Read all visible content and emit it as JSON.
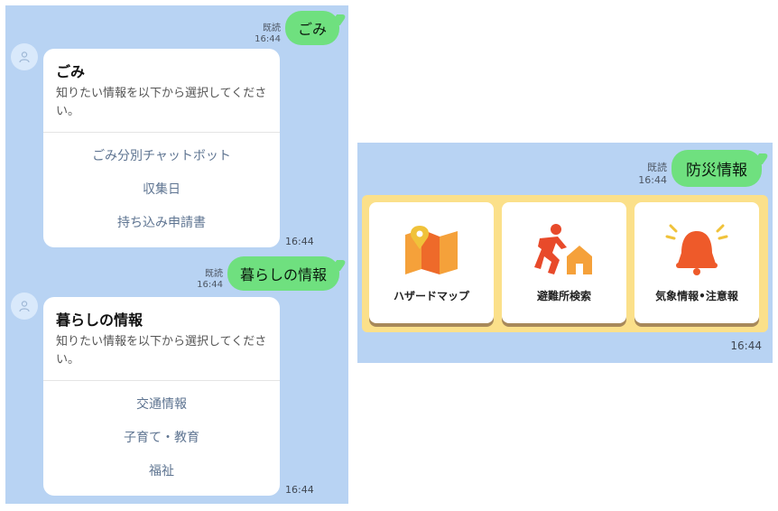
{
  "left": {
    "msg1": {
      "read": "既読",
      "time": "16:44",
      "text": "ごみ"
    },
    "card1": {
      "title": "ごみ",
      "desc": "知りたい情報を以下から選択してください。",
      "buttons": [
        "ごみ分別チャットボット",
        "収集日",
        "持ち込み申請書"
      ],
      "time": "16:44"
    },
    "msg2": {
      "read": "既読",
      "time": "16:44",
      "text": "暮らしの情報"
    },
    "card2": {
      "title": "暮らしの情報",
      "desc": "知りたい情報を以下から選択してください。",
      "buttons": [
        "交通情報",
        "子育て・教育",
        "福祉"
      ],
      "time": "16:44"
    }
  },
  "right": {
    "msg": {
      "read": "既読",
      "time": "16:44",
      "text": "防災情報"
    },
    "tiles": [
      {
        "label": "ハザードマップ",
        "icon": "map-pin-icon"
      },
      {
        "label": "避難所検索",
        "icon": "evacuation-run-icon"
      },
      {
        "label": "気象情報•注意報",
        "icon": "alarm-bell-icon"
      }
    ],
    "time": "16:44"
  },
  "colors": {
    "chat_bg": "#b8d3f3",
    "bubble_green": "#6fe07f",
    "banner_yellow": "#fbe08a",
    "link_text": "#5e7491",
    "icon_orange": "#f07a2a"
  }
}
